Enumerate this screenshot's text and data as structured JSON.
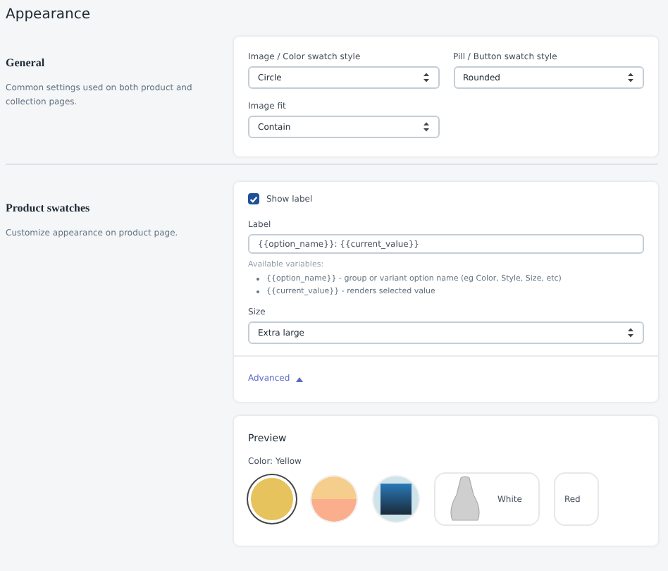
{
  "page_title": "Appearance",
  "sections": [
    {
      "kind": "general",
      "heading": "General",
      "description": "Common settings used on both product and collection pages.",
      "selects": [
        {
          "label": "Image / Color swatch style",
          "value": "Circle"
        },
        {
          "label": "Pill / Button swatch style",
          "value": "Rounded"
        },
        {
          "label": "Image fit",
          "value": "Contain"
        }
      ]
    },
    {
      "kind": "product",
      "heading": "Product swatches",
      "description": "Customize appearance on product page.",
      "show_label": {
        "label": "Show label",
        "checked": true
      },
      "label_field": {
        "label": "Label",
        "value": "{{option_name}}: {{current_value}}"
      },
      "variables_title": "Available variables:",
      "variables": [
        "{{option_name}} - group or variant option name (eg Color, Style, Size, etc)",
        "{{current_value}} - renders selected value"
      ],
      "size_select": {
        "label": "Size",
        "value": "Extra large"
      },
      "advanced": {
        "label": "Advanced",
        "expanded": true
      }
    }
  ],
  "preview": {
    "title": "Preview",
    "caption": "Color: Yellow",
    "swatches": [
      {
        "kind": "color",
        "color": "#e6c35c",
        "selected": true
      },
      {
        "kind": "split",
        "halves": [
          {
            "color": "#f5cd8c"
          },
          {
            "color": "#fbae8c"
          }
        ],
        "selected": false
      },
      {
        "kind": "image",
        "selected": false
      },
      {
        "kind": "pill-image",
        "label": "White",
        "selected": false
      },
      {
        "kind": "pill",
        "label": "Red",
        "selected": false
      }
    ]
  }
}
